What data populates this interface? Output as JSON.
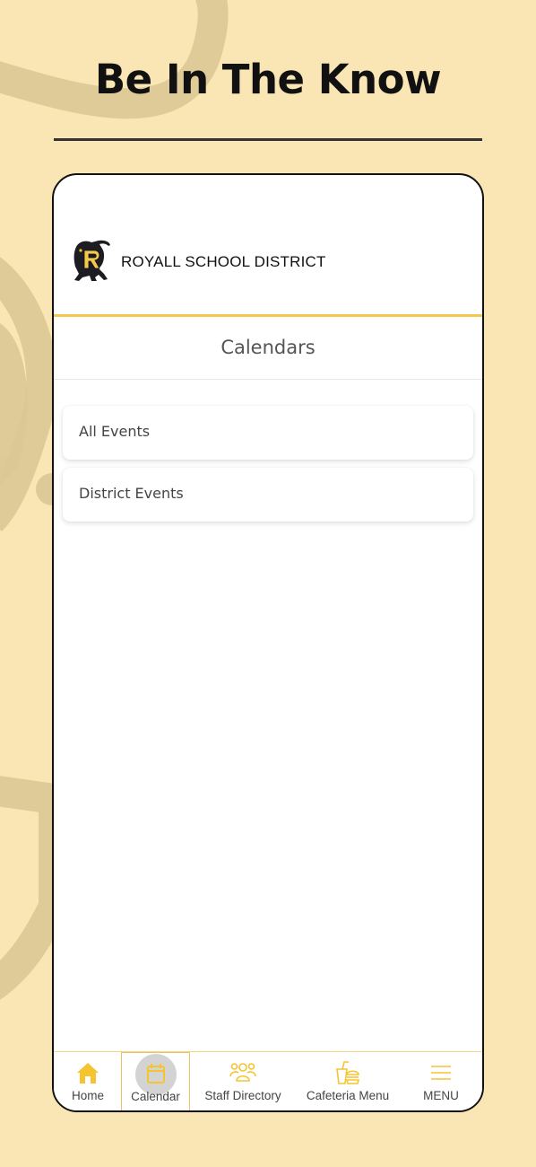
{
  "promo": {
    "headline": "Be In The Know"
  },
  "app": {
    "district_name": "ROYALL SCHOOL DISTRICT",
    "page_title": "Calendars",
    "calendars": [
      {
        "label": "All Events"
      },
      {
        "label": "District Events"
      }
    ]
  },
  "tabbar": {
    "items": [
      {
        "label": "Home",
        "icon": "home-icon"
      },
      {
        "label": "Calendar",
        "icon": "calendar-icon",
        "active": true
      },
      {
        "label": "Staff Directory",
        "icon": "people-icon"
      },
      {
        "label": "Cafeteria Menu",
        "icon": "food-icon"
      },
      {
        "label": "MENU",
        "icon": "menu-icon"
      }
    ]
  },
  "colors": {
    "background": "#f9e6b4",
    "accent": "#f2c94c",
    "icon": "#f5c431",
    "frame": "#111111"
  }
}
